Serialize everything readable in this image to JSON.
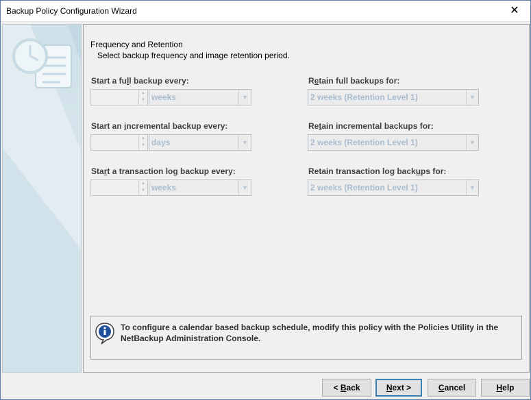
{
  "window": {
    "title": "Backup Policy Configuration Wizard",
    "close_glyph": "✕"
  },
  "header": {
    "title": "Frequency and Retention",
    "subtitle": "Select backup frequency and image retention period."
  },
  "frequency": {
    "full": {
      "label_pre": "Start a fu",
      "label_mn": "l",
      "label_post": "l backup every:",
      "value": "",
      "unit": "weeks"
    },
    "incremental": {
      "label_pre": "Start an ",
      "label_mn": "i",
      "label_post": "ncremental backup every:",
      "value": "",
      "unit": "days"
    },
    "transaction": {
      "label_pre": "Sta",
      "label_mn": "r",
      "label_post": "t a transaction log backup every:",
      "value": "",
      "unit": "weeks"
    }
  },
  "retention": {
    "full": {
      "label_pre": "R",
      "label_mn": "e",
      "label_post": "tain full backups for:",
      "value": "2 weeks (Retention Level 1)"
    },
    "incremental": {
      "label_pre": "Re",
      "label_mn": "t",
      "label_post": "ain incremental backups for:",
      "value": "2 weeks (Retention Level 1)"
    },
    "transaction": {
      "label_pre": "Retain transaction log back",
      "label_mn": "u",
      "label_post": "ps for:",
      "value": "2 weeks (Retention Level 1)"
    }
  },
  "info": {
    "text": "To configure a calendar based backup schedule, modify this policy with the Policies Utility in the NetBackup Administration Console."
  },
  "buttons": {
    "back": {
      "pre": "< ",
      "mn": "B",
      "post": "ack"
    },
    "next": {
      "pre": "",
      "mn": "N",
      "post": "ext >"
    },
    "cancel": {
      "pre": "",
      "mn": "C",
      "post": "ancel"
    },
    "help": {
      "pre": "",
      "mn": "H",
      "post": "elp"
    }
  },
  "colors": {
    "accent": "#3c7fb1",
    "disabled_text": "#a9bcd0",
    "side_panel": "#d8e6ed"
  },
  "icons": {
    "close": "close-icon",
    "wizard": "clock-scroll-icon",
    "info": "info-icon",
    "spinner": "spinner-arrows-icon",
    "dropdown": "chevron-down-icon"
  }
}
